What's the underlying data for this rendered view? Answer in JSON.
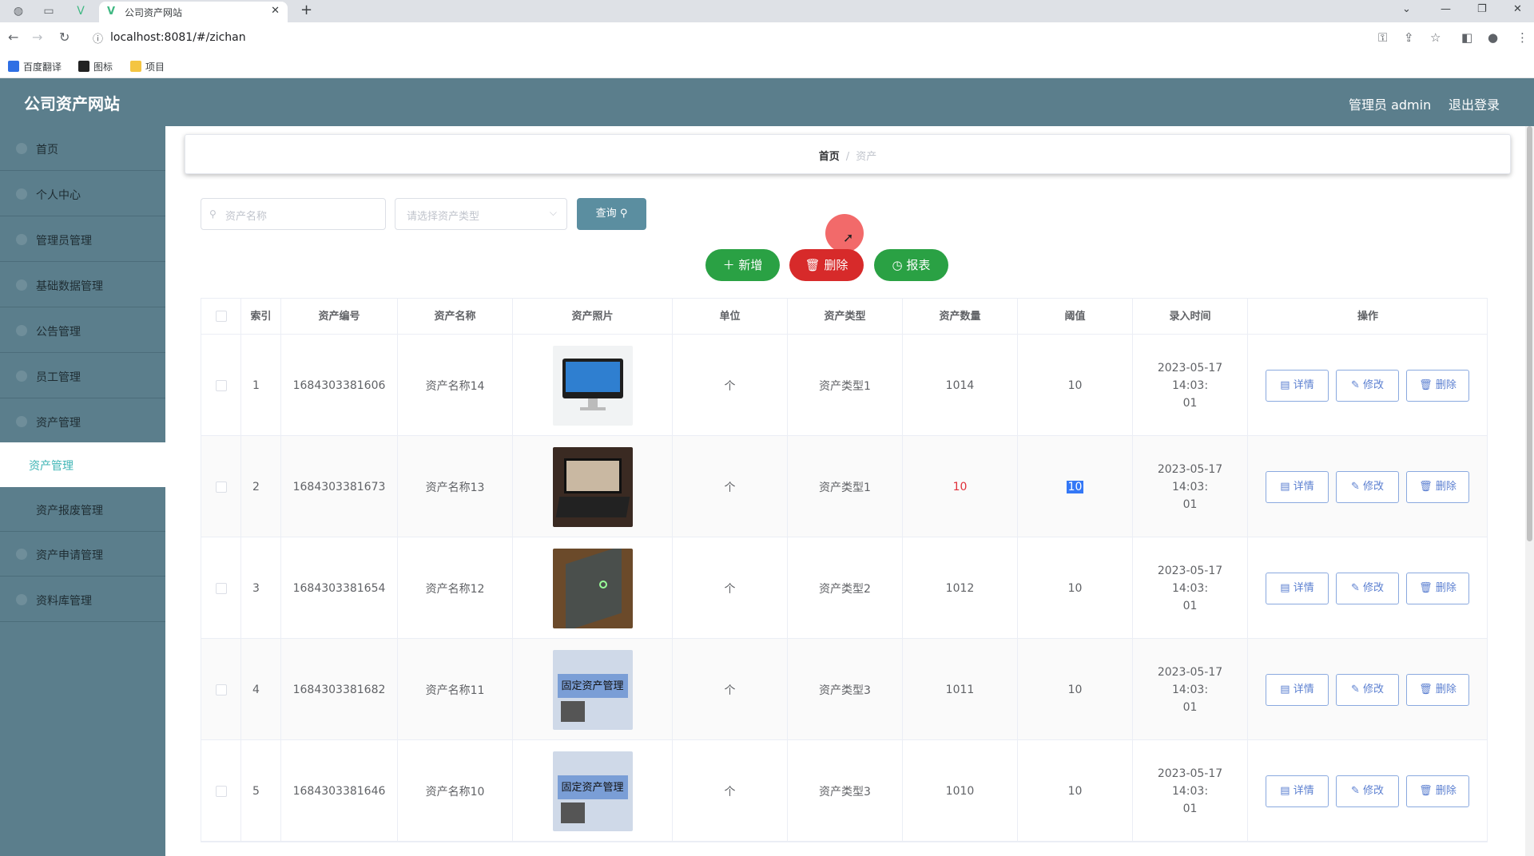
{
  "browser": {
    "tab_title": "公司资产网站",
    "url": "localhost:8081/#/zichan",
    "bookmarks": [
      "百度翻译",
      "图标",
      "项目"
    ]
  },
  "header": {
    "app_title": "公司资产网站",
    "user": "管理员 admin",
    "logout": "退出登录"
  },
  "sidebar": {
    "items": [
      {
        "label": "首页"
      },
      {
        "label": "个人中心"
      },
      {
        "label": "管理员管理"
      },
      {
        "label": "基础数据管理"
      },
      {
        "label": "公告管理"
      },
      {
        "label": "员工管理"
      },
      {
        "label": "资产管理"
      },
      {
        "label": "资产管理"
      },
      {
        "label": "资产报废管理"
      },
      {
        "label": "资产申请管理"
      },
      {
        "label": "资料库管理"
      }
    ],
    "active_index": 7
  },
  "breadcrumb": {
    "home": "首页",
    "separator": "/",
    "current": "资产"
  },
  "search": {
    "name_placeholder": "资产名称",
    "type_placeholder": "请选择资产类型",
    "query_label": "查询"
  },
  "actions": {
    "add": "新增",
    "delete": "删除",
    "report": "报表"
  },
  "table": {
    "headers": [
      "索引",
      "资产编号",
      "资产名称",
      "资产照片",
      "单位",
      "资产类型",
      "资产数量",
      "阈值",
      "录入时间",
      "操作"
    ],
    "op_labels": {
      "detail": "详情",
      "edit": "修改",
      "delete": "删除"
    },
    "rows": [
      {
        "index": "1",
        "code": "1684303381606",
        "name": "资产名称14",
        "photo": "imac-icon",
        "unit": "个",
        "type": "资产类型1",
        "qty": "1014",
        "threshold": "10",
        "time1": "2023-05-17 14:03:",
        "time2": "01"
      },
      {
        "index": "2",
        "code": "1684303381673",
        "name": "资产名称13",
        "photo": "laptop-photo",
        "unit": "个",
        "type": "资产类型1",
        "qty": "10",
        "threshold": "10",
        "time1": "2023-05-17 14:03:",
        "time2": "01"
      },
      {
        "index": "3",
        "code": "1684303381654",
        "name": "资产名称12",
        "photo": "laptop-dark-photo",
        "unit": "个",
        "type": "资产类型2",
        "qty": "1012",
        "threshold": "10",
        "time1": "2023-05-17 14:03:",
        "time2": "01"
      },
      {
        "index": "4",
        "code": "1684303381682",
        "name": "资产名称11",
        "photo": "fixed-asset-photo",
        "photo_text": "固定资产管理",
        "unit": "个",
        "type": "资产类型3",
        "qty": "1011",
        "threshold": "10",
        "time1": "2023-05-17 14:03:",
        "time2": "01"
      },
      {
        "index": "5",
        "code": "1684303381646",
        "name": "资产名称10",
        "photo": "fixed-asset-photo",
        "photo_text": "固定资产管理",
        "unit": "个",
        "type": "资产类型3",
        "qty": "1010",
        "threshold": "10",
        "time1": "2023-05-17 14:03:",
        "time2": "01"
      }
    ]
  },
  "colors": {
    "header_bg": "#5b7e8c",
    "green": "#2aa144",
    "red": "#d72a2a",
    "link_blue": "#5b7fd0",
    "active_teal": "#3fb5b5"
  }
}
